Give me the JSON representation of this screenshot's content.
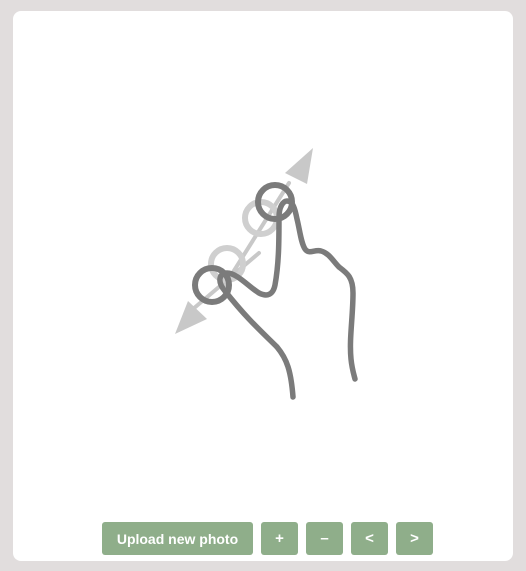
{
  "toolbar": {
    "upload_label": "Upload new photo",
    "zoom_in_label": "+",
    "zoom_out_label": "–",
    "prev_label": "<",
    "next_label": ">"
  },
  "illustration": {
    "icon": "pinch-zoom-gesture-icon",
    "colors": {
      "hand": "#7b7b7b",
      "ghost": "#cfcfcf",
      "arrow": "#c8c8c8"
    }
  },
  "colors": {
    "background": "#e1dddd",
    "panel": "#ffffff",
    "button": "#8fae8a"
  }
}
